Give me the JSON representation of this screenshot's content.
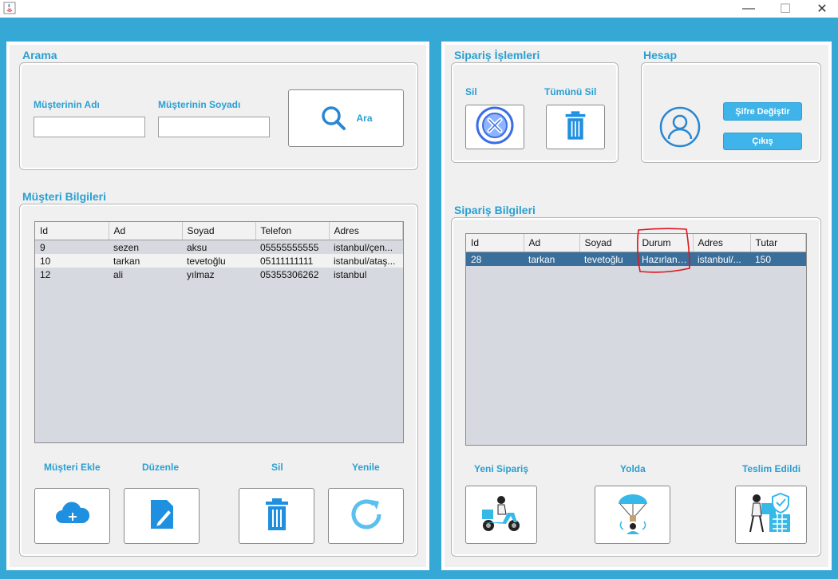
{
  "window": {
    "minimize": "—",
    "maximize": "☐",
    "close": "✕"
  },
  "left": {
    "search": {
      "title": "Arama",
      "first_name_label": "Müşterinin Adı",
      "first_name_value": "",
      "last_name_label": "Müşterinin Soyadı",
      "last_name_value": "",
      "search_button": "Ara"
    },
    "customers": {
      "title": "Müşteri Bilgileri",
      "columns": [
        "Id",
        "Ad",
        "Soyad",
        "Telefon",
        "Adres"
      ],
      "rows": [
        [
          "9",
          "sezen",
          "aksu",
          "05555555555",
          "istanbul/çen..."
        ],
        [
          "10",
          "tarkan",
          "tevetoğlu",
          "05111111111",
          "istanbul/ataş..."
        ],
        [
          "12",
          "ali",
          "yılmaz",
          "05355306262",
          "istanbul"
        ]
      ],
      "actions": {
        "add": "Müşteri Ekle",
        "edit": "Düzenle",
        "delete": "Sil",
        "refresh": "Yenile"
      }
    }
  },
  "right": {
    "order_ops": {
      "title": "Sipariş İşlemleri",
      "delete": "Sil",
      "delete_all": "Tümünü Sil"
    },
    "account": {
      "title": "Hesap",
      "change_password": "Şifre Değiştir",
      "logout": "Çıkış"
    },
    "orders": {
      "title": "Sipariş Bilgileri",
      "columns": [
        "Id",
        "Ad",
        "Soyad",
        "Durum",
        "Adres",
        "Tutar"
      ],
      "rows": [
        [
          "28",
          "tarkan",
          "tevetoğlu",
          "Hazırlanı...",
          "istanbul/...",
          "150"
        ]
      ],
      "status_actions": {
        "new": "Yeni Sipariş",
        "on_the_way": "Yolda",
        "delivered": "Teslim Edildi"
      }
    }
  },
  "colors": {
    "accent": "#36a8d6",
    "label": "#2a9fd1",
    "selection": "#3a6e9b",
    "annotation": "#e0141e"
  }
}
